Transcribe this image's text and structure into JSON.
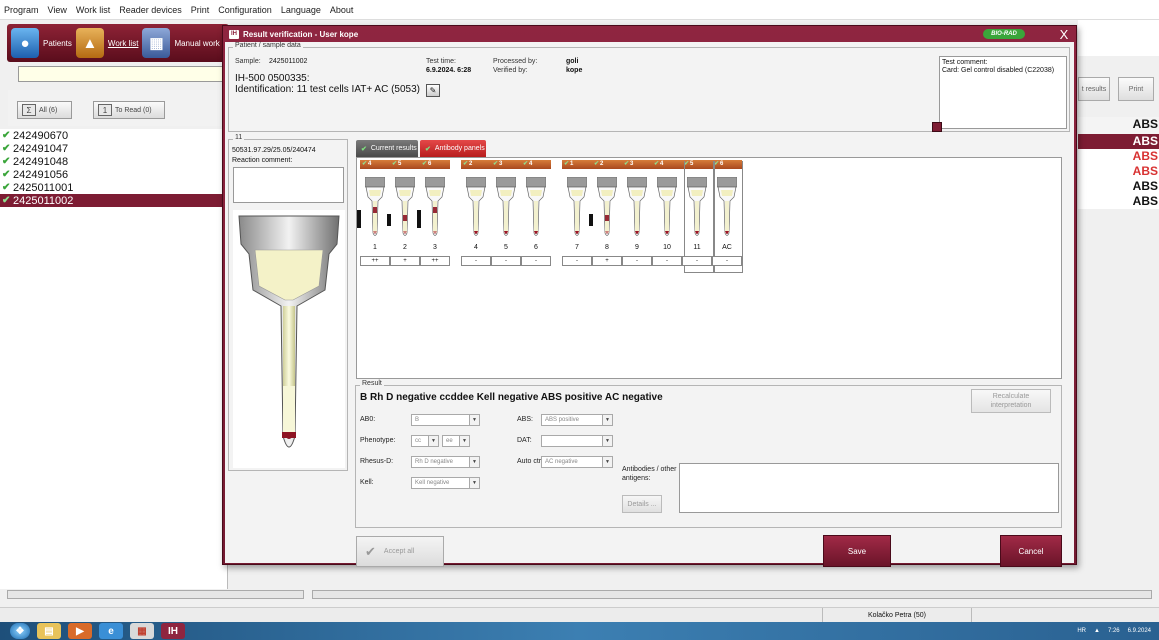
{
  "menu": [
    "Program",
    "View",
    "Work list",
    "Reader devices",
    "Print",
    "Configuration",
    "Language",
    "About"
  ],
  "nav": {
    "patients": "Patients",
    "worklist": "Work list",
    "manual": "Manual work"
  },
  "toolbar": {
    "all": "All (6)",
    "to_read": "To Read (0)"
  },
  "samples": [
    "242490670",
    "242491047",
    "242491048",
    "242491056",
    "2425011001",
    "2425011002"
  ],
  "right_panel": {
    "results_btn": "t results",
    "print_btn": "Print",
    "header": "ABS",
    "rows": [
      "ABS",
      "ABS",
      "ABS",
      "ABS",
      "ABS"
    ]
  },
  "status_user": "Kolačko Petra (50)",
  "tray": {
    "lang": "HR",
    "time": "7:26",
    "date": "6.9.2024"
  },
  "dialog": {
    "title": "Result verification - User kope",
    "logo": "BIO-RAD",
    "close": "X",
    "patient_group": "Patient / sample data",
    "sample_label": "Sample:",
    "sample_value": "2425011002",
    "id_line1": "IH-500 0500335:",
    "id_line2": "Identification: 11 test cells IAT+ AC (5053)",
    "test_time_label": "Test time:",
    "test_time_value": "6.9.2024. 6:28",
    "processed_label": "Processed by:",
    "processed_value": "goli",
    "verified_label": "Verified by:",
    "verified_value": "kope",
    "comment_label": "Test comment:",
    "comment_text": "Card: Gel control disabled (C22038)",
    "well_group": "11",
    "well_id": "50531.97.29/25.05/240474",
    "reaction_label": "Reaction comment:",
    "tab_current": "Current results",
    "tab_panels": "Antibody panels",
    "groups": [
      [
        "4",
        "5",
        "6"
      ],
      [
        "2",
        "3",
        "4"
      ],
      [
        "1",
        "2",
        "3",
        "4",
        "5",
        "6"
      ]
    ],
    "tube_numbers": [
      "1",
      "2",
      "3",
      "4",
      "5",
      "6",
      "7",
      "8",
      "9",
      "10",
      "11",
      "AC"
    ],
    "tube_results": [
      "++",
      "+",
      "++",
      "-",
      "-",
      "-",
      "-",
      "+",
      "-",
      "-",
      "-",
      "-"
    ],
    "result_group": "Result",
    "result_text": "B Rh D negative ccddee Kell negative ABS positive AC negative",
    "recalc": "Recalculate interpretation",
    "abo_label": "AB0:",
    "abo_value": "B",
    "abs_label": "ABS:",
    "abs_value": "ABS positive",
    "pheno_label": "Phenotype:",
    "pheno_value1": "cc",
    "pheno_value2": "ee",
    "dat_label": "DAT:",
    "rhd_label": "Rhesus-D:",
    "rhd_value": "Rh D negative",
    "autoctrl_label": "Auto ctrl.:",
    "autoctrl_value": "AC negative",
    "kell_label": "Kell:",
    "kell_value": "Kell negative",
    "antibodies_label1": "Antibodies / other",
    "antibodies_label2": "antigens:",
    "details": "Details ...",
    "accept_all": "Accept all",
    "save": "Save",
    "cancel": "Cancel"
  },
  "colors": {
    "brand": "#7d1c33",
    "panel_tab": "#d22e2e",
    "check": "#3aa53a"
  }
}
